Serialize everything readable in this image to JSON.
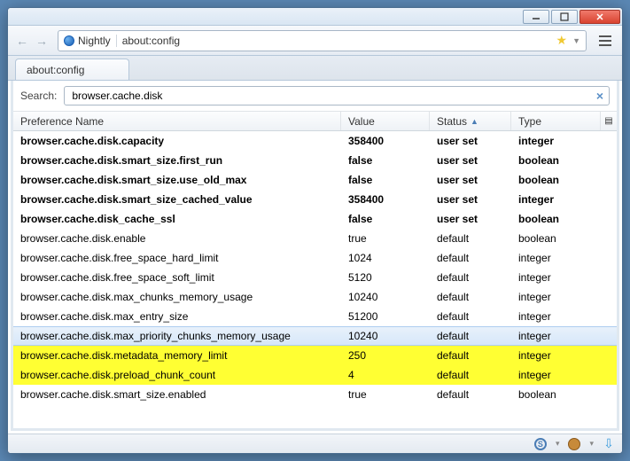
{
  "window": {
    "identity_label": "Nightly",
    "url": "about:config",
    "tab_title": "about:config"
  },
  "search": {
    "label": "Search:",
    "value": "browser.cache.disk"
  },
  "columns": {
    "name": "Preference Name",
    "value": "Value",
    "status": "Status",
    "type": "Type"
  },
  "rows": [
    {
      "name": "browser.cache.disk.capacity",
      "value": "358400",
      "status": "user set",
      "type": "integer",
      "userset": true
    },
    {
      "name": "browser.cache.disk.smart_size.first_run",
      "value": "false",
      "status": "user set",
      "type": "boolean",
      "userset": true
    },
    {
      "name": "browser.cache.disk.smart_size.use_old_max",
      "value": "false",
      "status": "user set",
      "type": "boolean",
      "userset": true
    },
    {
      "name": "browser.cache.disk.smart_size_cached_value",
      "value": "358400",
      "status": "user set",
      "type": "integer",
      "userset": true
    },
    {
      "name": "browser.cache.disk_cache_ssl",
      "value": "false",
      "status": "user set",
      "type": "boolean",
      "userset": true
    },
    {
      "name": "browser.cache.disk.enable",
      "value": "true",
      "status": "default",
      "type": "boolean"
    },
    {
      "name": "browser.cache.disk.free_space_hard_limit",
      "value": "1024",
      "status": "default",
      "type": "integer"
    },
    {
      "name": "browser.cache.disk.free_space_soft_limit",
      "value": "5120",
      "status": "default",
      "type": "integer"
    },
    {
      "name": "browser.cache.disk.max_chunks_memory_usage",
      "value": "10240",
      "status": "default",
      "type": "integer"
    },
    {
      "name": "browser.cache.disk.max_entry_size",
      "value": "51200",
      "status": "default",
      "type": "integer"
    },
    {
      "name": "browser.cache.disk.max_priority_chunks_memory_usage",
      "value": "10240",
      "status": "default",
      "type": "integer",
      "selected": true
    },
    {
      "name": "browser.cache.disk.metadata_memory_limit",
      "value": "250",
      "status": "default",
      "type": "integer",
      "highlight": true
    },
    {
      "name": "browser.cache.disk.preload_chunk_count",
      "value": "4",
      "status": "default",
      "type": "integer",
      "highlight": true
    },
    {
      "name": "browser.cache.disk.smart_size.enabled",
      "value": "true",
      "status": "default",
      "type": "boolean"
    }
  ]
}
